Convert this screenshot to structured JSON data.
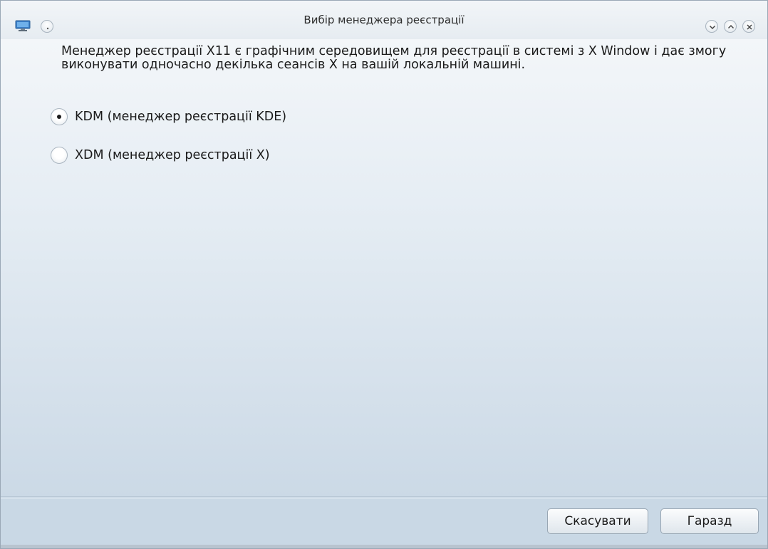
{
  "window": {
    "title": "Вибір менеджера реєстрації"
  },
  "titlebar_icons": {
    "app": "monitor-icon",
    "menu": "window-menu-icon",
    "minimize": "minimize-icon",
    "maximize": "maximize-icon",
    "close": "close-icon"
  },
  "description": "Менеджер реєстрації X11 є графічним середовищем для реєстрації в системі з X Window і дає змогу виконувати одночасно декілька сеансів X на вашій локальній машині.",
  "options": [
    {
      "label": "KDM (менеджер реєстрації KDE)",
      "checked": true
    },
    {
      "label": "XDM (менеджер реєстрації X)",
      "checked": false
    }
  ],
  "buttons": {
    "cancel": "Скасувати",
    "ok": "Гаразд"
  },
  "colors": {
    "background": "#c9d8e5",
    "titlebar": "#eef2f6",
    "text": "#1a1a1a"
  }
}
